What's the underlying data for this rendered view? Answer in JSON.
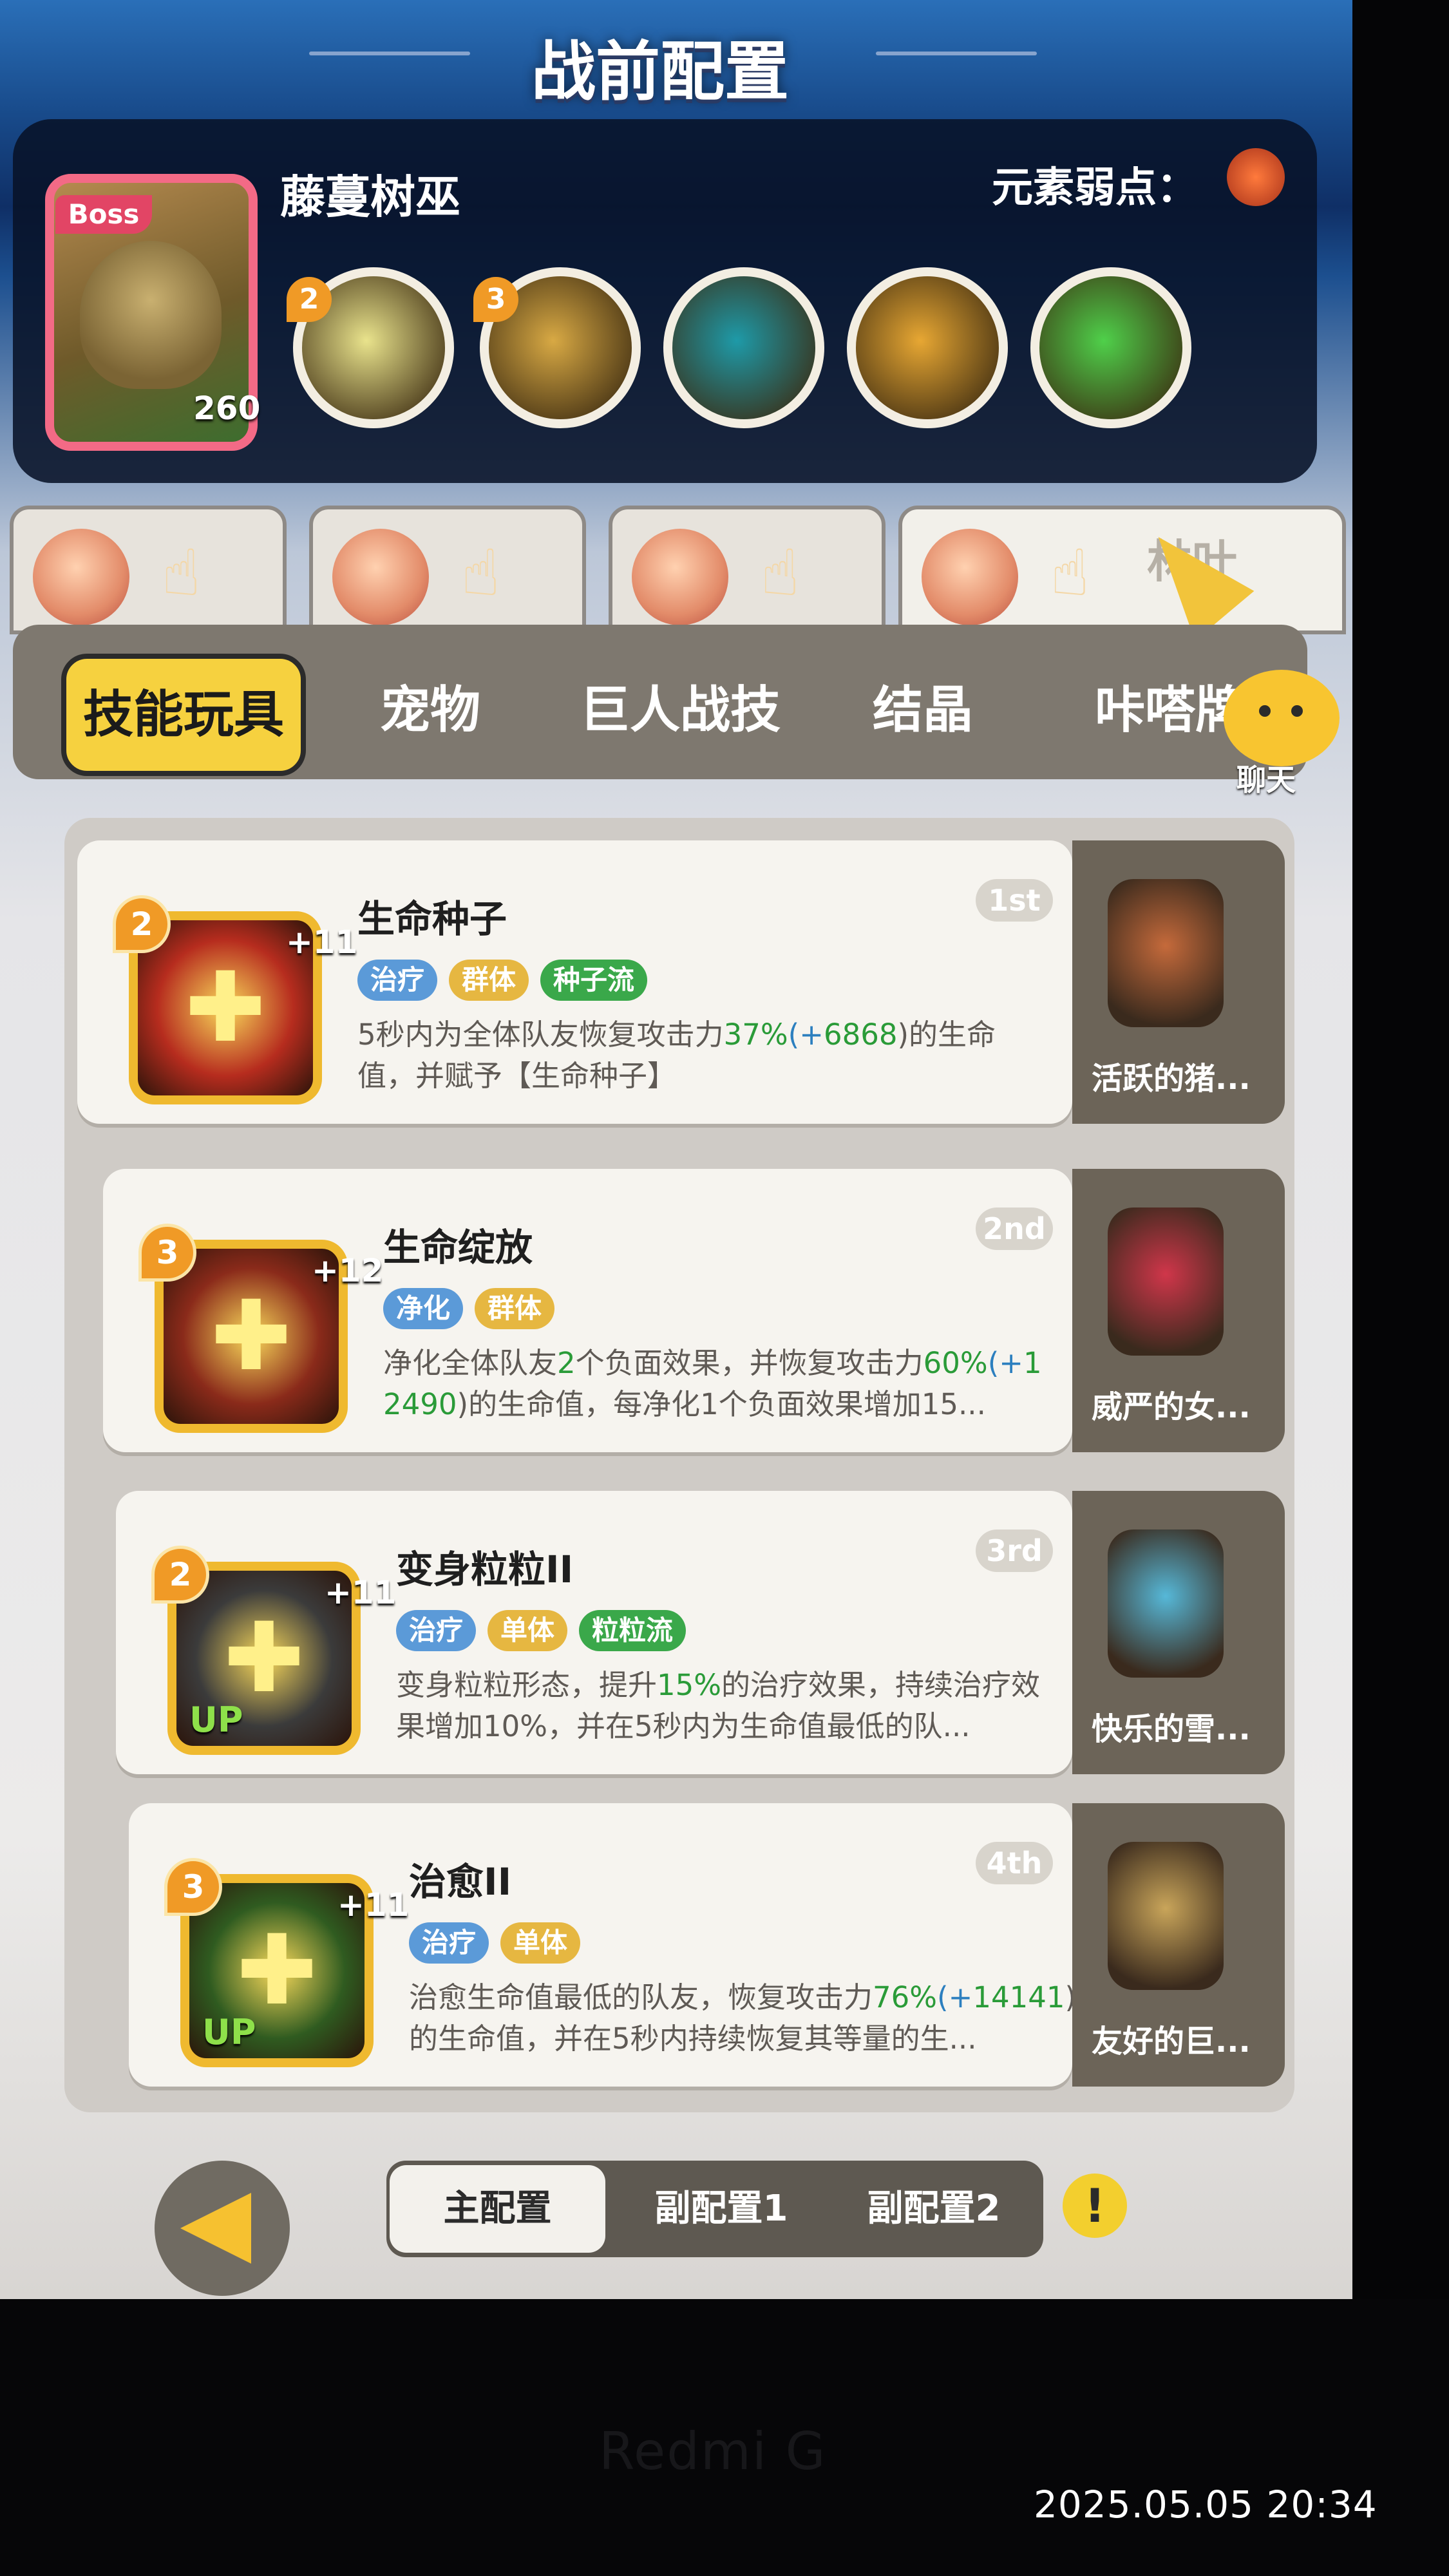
{
  "header": {
    "title": "战前配置",
    "boss_name": "藤蔓树巫",
    "boss_tag": "Boss",
    "boss_level": "260",
    "weakness_label": "元素弱点：",
    "boss_skills": [
      {
        "count": "2",
        "color": "#e9e38c",
        "icon": "burst-icon"
      },
      {
        "count": "3",
        "color": "#d8a944",
        "icon": "flame-icon"
      },
      {
        "count": "",
        "color": "#1e9aa8",
        "icon": "shadow-icon"
      },
      {
        "count": "",
        "color": "#e7a733",
        "icon": "claw-icon"
      },
      {
        "count": "",
        "color": "#4fd04a",
        "icon": "slime-icon"
      }
    ]
  },
  "players": [
    {
      "name": ""
    },
    {
      "name": ""
    },
    {
      "name": ""
    },
    {
      "name": "林叶"
    }
  ],
  "categories": [
    "技能玩具",
    "宠物",
    "巨人战技",
    "结晶",
    "咔嗒牌"
  ],
  "chat_label": "聊天",
  "skills": [
    {
      "name": "生命种子",
      "rank": "1st",
      "level": "2",
      "plus": "+11",
      "up": "",
      "tags": [
        {
          "text": "治疗",
          "color": "#5b9ad8"
        },
        {
          "text": "群体",
          "color": "#e6b741"
        },
        {
          "text": "种子流",
          "color": "#3aa84a"
        }
      ],
      "desc": [
        "5秒内为全体队友恢复攻击力",
        "37%",
        "(+",
        "6868",
        ")的生命值，并赋予【生命种子】"
      ],
      "pet": "活跃的猪...",
      "icon_color": "#b62c1e",
      "pet_color": "#c56a3b"
    },
    {
      "name": "生命绽放",
      "rank": "2nd",
      "level": "3",
      "plus": "+12",
      "up": "",
      "tags": [
        {
          "text": "净化",
          "color": "#5b9ad8"
        },
        {
          "text": "群体",
          "color": "#e6b741"
        }
      ],
      "desc": [
        "净化全体队友",
        "2",
        "个负面效果，并恢复攻击力",
        "60%",
        "(+",
        "12490",
        ")的生命值，每净化1个负面效果增加15..."
      ],
      "pet": "威严的女...",
      "icon_color": "#8a2a1a",
      "pet_color": "#d0364a"
    },
    {
      "name": "变身粒粒II",
      "rank": "3rd",
      "level": "2",
      "plus": "+11",
      "up": "UP",
      "tags": [
        {
          "text": "治疗",
          "color": "#5b9ad8"
        },
        {
          "text": "单体",
          "color": "#e6b741"
        },
        {
          "text": "粒粒流",
          "color": "#3aa84a"
        }
      ],
      "desc": [
        "变身粒粒形态，提升",
        "15%",
        "的治疗效果，持续治疗效果增加10%，并在5秒内为生命值最低的队..."
      ],
      "pet": "快乐的雪...",
      "icon_color": "#3b3b3b",
      "pet_color": "#56b8d8"
    },
    {
      "name": "治愈II",
      "rank": "4th",
      "level": "3",
      "plus": "+11",
      "up": "UP",
      "tags": [
        {
          "text": "治疗",
          "color": "#5b9ad8"
        },
        {
          "text": "单体",
          "color": "#e6b741"
        }
      ],
      "desc": [
        "治愈生命值最低的队友，恢复攻击力",
        "76%",
        "(+",
        "14141",
        ")的生命值，并在5秒内持续恢复其等量的生..."
      ],
      "pet": "友好的巨...",
      "icon_color": "#2f5b20",
      "pet_color": "#c9a55a"
    }
  ],
  "bottom": {
    "configs": [
      "主配置",
      "副配置1",
      "副配置2"
    ],
    "info": "!"
  },
  "device": {
    "brand": "Redmi G",
    "timestamp": "2025.05.05  20:34"
  }
}
